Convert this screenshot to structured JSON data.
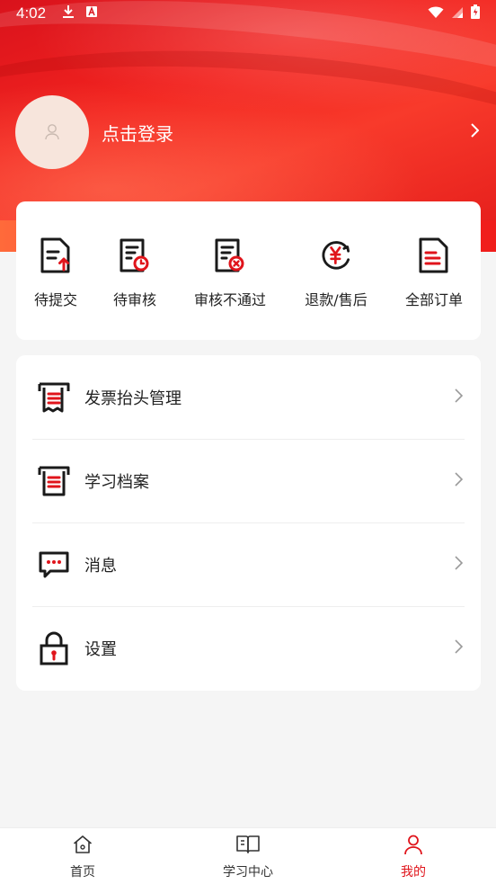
{
  "status_bar": {
    "time": "4:02"
  },
  "profile": {
    "login_label": "点击登录"
  },
  "orders": [
    {
      "label": "待提交",
      "icon": "doc-upload-icon"
    },
    {
      "label": "待审核",
      "icon": "doc-clock-icon"
    },
    {
      "label": "审核不通过",
      "icon": "doc-reject-icon"
    },
    {
      "label": "退款/售后",
      "icon": "yuan-refund-icon"
    },
    {
      "label": "全部订单",
      "icon": "doc-list-icon"
    }
  ],
  "menu": [
    {
      "label": "发票抬头管理",
      "icon": "invoice-icon"
    },
    {
      "label": "学习档案",
      "icon": "archive-icon"
    },
    {
      "label": "消息",
      "icon": "message-icon"
    },
    {
      "label": "设置",
      "icon": "lock-icon"
    }
  ],
  "tabs": [
    {
      "label": "首页",
      "icon": "home-icon",
      "active": false
    },
    {
      "label": "学习中心",
      "icon": "book-icon",
      "active": false
    },
    {
      "label": "我的",
      "icon": "user-icon",
      "active": true
    }
  ],
  "colors": {
    "accent": "#e0141b",
    "icon_dark": "#1a1a1a",
    "hero_red": "#f2231f"
  }
}
